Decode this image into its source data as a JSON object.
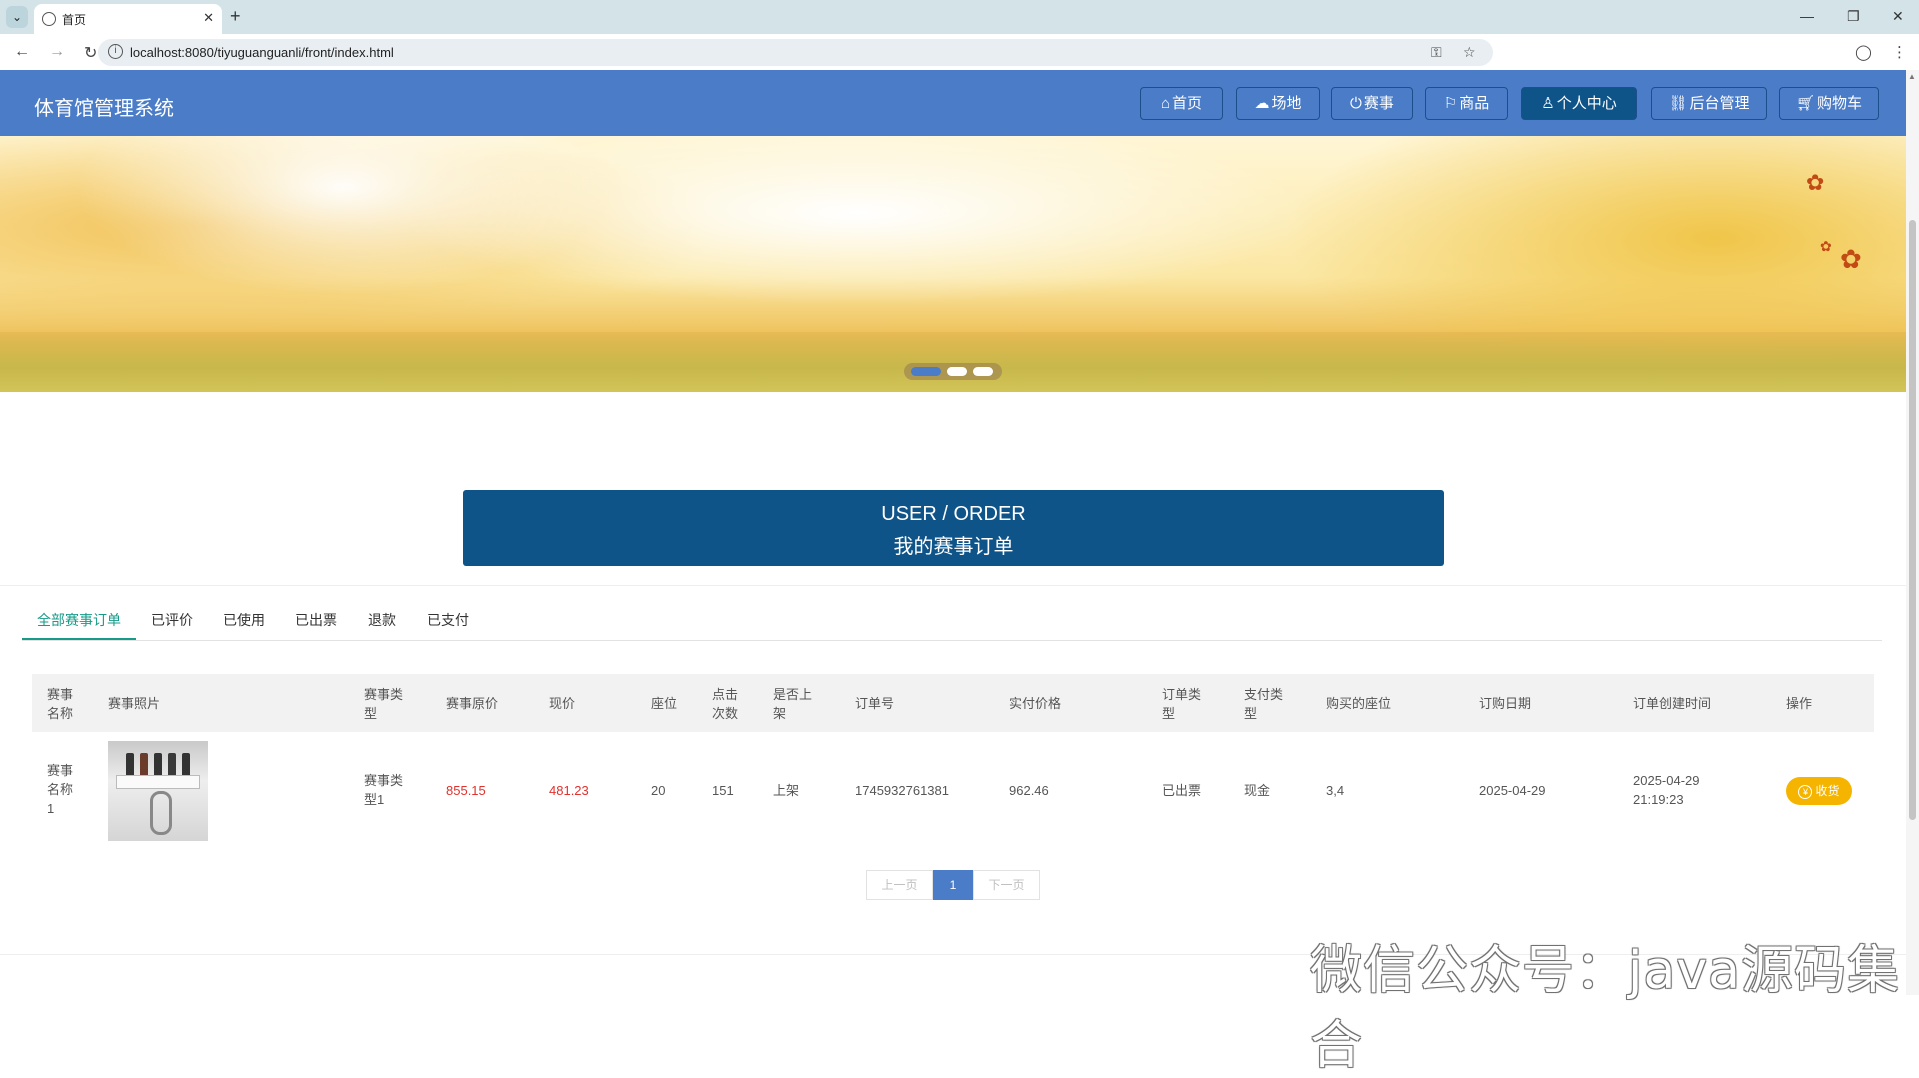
{
  "browser": {
    "tab_title": "首页",
    "url": "localhost:8080/tiyuguanguanli/front/index.html",
    "icons": [
      "tab-search-icon",
      "globe-icon",
      "close-icon",
      "plus-icon",
      "minimize-icon",
      "restore-icon",
      "close-window-icon",
      "back-icon",
      "forward-icon",
      "reload-icon",
      "info-icon",
      "key-icon",
      "star-icon",
      "profile-icon",
      "kebab-menu-icon"
    ]
  },
  "site": {
    "title": "体育馆管理系统",
    "nav": [
      {
        "label": "首页",
        "icon": "home-icon"
      },
      {
        "label": "场地",
        "icon": "cloud-icon"
      },
      {
        "label": "赛事",
        "icon": "power-icon"
      },
      {
        "label": "商品",
        "icon": "flag-icon"
      },
      {
        "label": "个人中心",
        "icon": "user-icon",
        "active": true
      },
      {
        "label": "后台管理",
        "icon": "link-icon"
      },
      {
        "label": "购物车",
        "icon": "cart-icon"
      }
    ],
    "accent": "#4a7cc7",
    "active_nav_color": "#0e5489"
  },
  "banner": {
    "slides": 3,
    "active_slide": 1
  },
  "section": {
    "title_en": "USER / ORDER",
    "title_cn": "我的赛事订单"
  },
  "order_tabs": [
    {
      "label": "全部赛事订单",
      "active": true
    },
    {
      "label": "已评价"
    },
    {
      "label": "已使用"
    },
    {
      "label": "已出票"
    },
    {
      "label": "退款"
    },
    {
      "label": "已支付"
    }
  ],
  "table": {
    "headers": [
      "赛事\n名称",
      "赛事照片",
      "赛事类\n型",
      "赛事原价",
      "现价",
      "座位",
      "点击\n次数",
      "是否上\n架",
      "订单号",
      "实付价格",
      "订单类\n型",
      "支付类\n型",
      "购买的座位",
      "订购日期",
      "订单创建时间",
      "操作"
    ],
    "rows": [
      {
        "name": "赛事\n名称\n1",
        "type": "赛事类\n型1",
        "original_price": "855.15",
        "current_price": "481.23",
        "seats": "20",
        "clicks": "151",
        "on_shelf": "上架",
        "order_no": "1745932761381",
        "paid_price": "962.46",
        "order_type": "已出票",
        "pay_type": "现金",
        "bought_seats": "3,4",
        "order_date": "2025-04-29",
        "created_at": "2025-04-29\n21:19:23",
        "action": "收货"
      }
    ]
  },
  "pagination": {
    "prev": "上一页",
    "current": "1",
    "next": "下一页"
  },
  "watermark": "微信公众号：java源码集合"
}
